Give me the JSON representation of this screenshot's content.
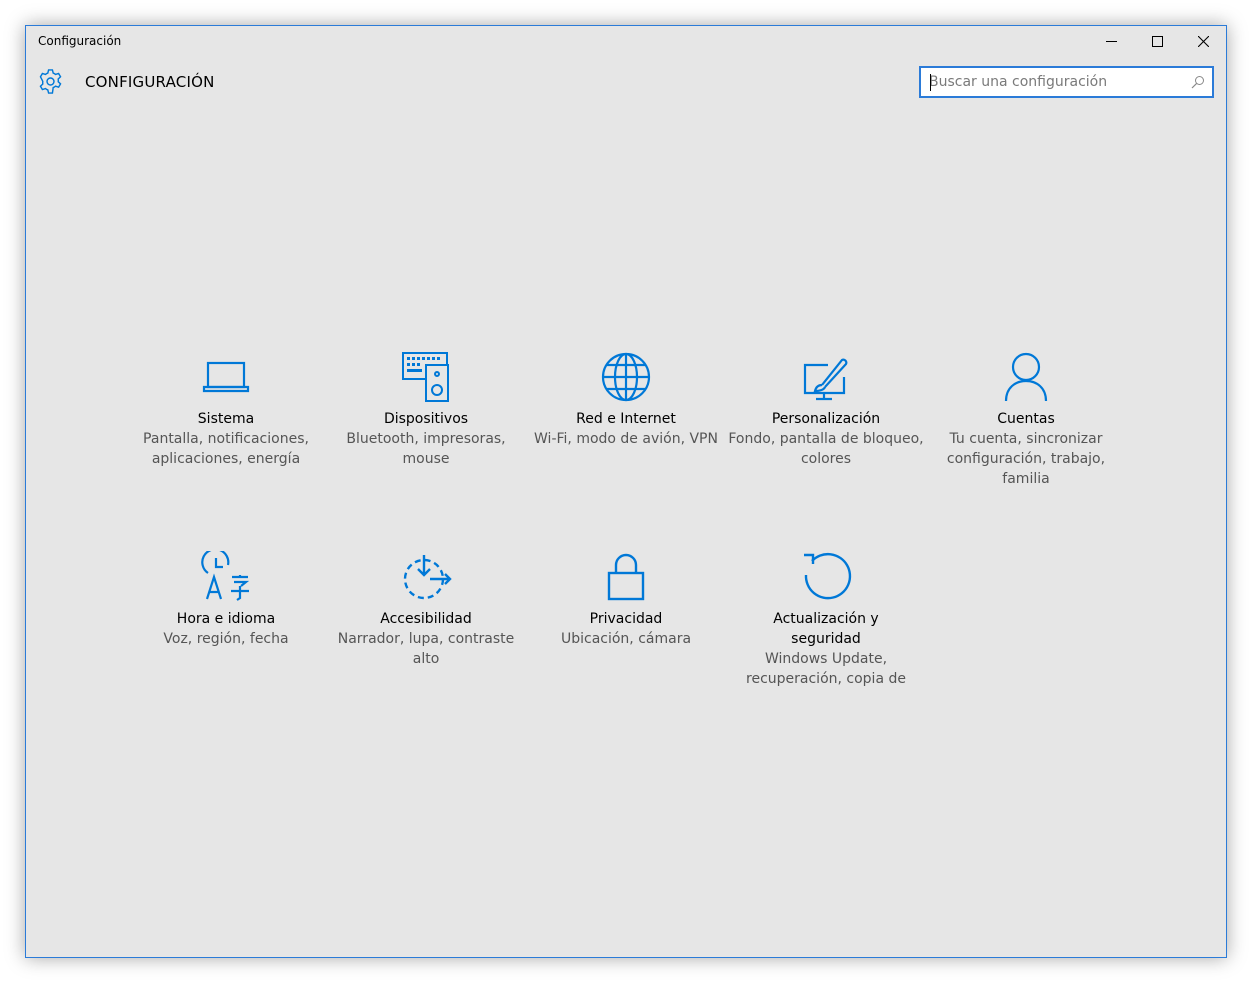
{
  "window": {
    "title": "Configuración"
  },
  "header": {
    "title": "CONFIGURACIÓN"
  },
  "search": {
    "placeholder": "Buscar una configuración"
  },
  "accent": "#0078d7",
  "tiles": [
    {
      "name": "Sistema",
      "desc": "Pantalla, notificaciones, aplicaciones, energía",
      "icon": "laptop-icon"
    },
    {
      "name": "Dispositivos",
      "desc": "Bluetooth, impresoras, mouse",
      "icon": "keyboard-speaker-icon"
    },
    {
      "name": "Red e Internet",
      "desc": "Wi-Fi, modo de avión, VPN",
      "icon": "globe-icon"
    },
    {
      "name": "Personalización",
      "desc": "Fondo, pantalla de bloqueo, colores",
      "icon": "paintbrush-monitor-icon"
    },
    {
      "name": "Cuentas",
      "desc": "Tu cuenta, sincronizar configuración, trabajo, familia",
      "icon": "person-icon"
    },
    {
      "name": "Hora e idioma",
      "desc": "Voz, región, fecha",
      "icon": "clock-language-icon"
    },
    {
      "name": "Accesibilidad",
      "desc": "Narrador, lupa, contraste alto",
      "icon": "ease-of-access-icon"
    },
    {
      "name": "Privacidad",
      "desc": "Ubicación, cámara",
      "icon": "lock-icon"
    },
    {
      "name": "Actualización y seguridad",
      "desc": "Windows Update, recuperación, copia de",
      "icon": "refresh-icon"
    }
  ]
}
